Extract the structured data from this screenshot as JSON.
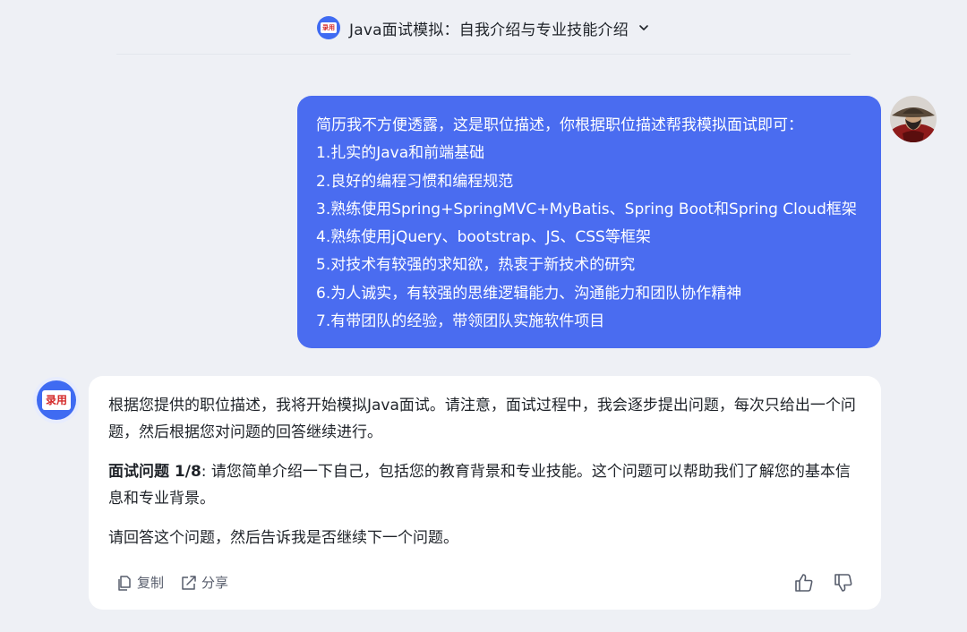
{
  "header": {
    "logo_text": "录用",
    "title": "Java面试模拟：自我介绍与专业技能介绍"
  },
  "user_message": {
    "lines": [
      "简历我不方便透露，这是职位描述，你根据职位描述帮我模拟面试即可：",
      "1.扎实的Java和前端基础",
      "2.良好的编程习惯和编程规范",
      "3.熟练使用Spring+SpringMVC+MyBatis、Spring Boot和Spring Cloud框架",
      "4.熟练使用jQuery、bootstrap、JS、CSS等框架",
      "5.对技术有较强的求知欲，热衷于新技术的研究",
      "6.为人诚实，有较强的思维逻辑能力、沟通能力和团队协作精神",
      "7.有带团队的经验，带领团队实施软件项目"
    ]
  },
  "assistant_message": {
    "avatar_text": "录用",
    "intro": "根据您提供的职位描述，我将开始模拟Java面试。请注意，面试过程中，我会逐步提出问题，每次只给出一个问题，然后根据您对问题的回答继续进行。",
    "question_label": "面试问题 1/8",
    "question_text": ": 请您简单介绍一下自己，包括您的教育背景和专业技能。这个问题可以帮助我们了解您的基本信息和专业背景。",
    "closing": "请回答这个问题，然后告诉我是否继续下一个问题。"
  },
  "actions": {
    "copy_label": "复制",
    "share_label": "分享"
  },
  "colors": {
    "accent": "#4a6cf0",
    "background": "#eef0f5",
    "card": "#ffffff"
  }
}
